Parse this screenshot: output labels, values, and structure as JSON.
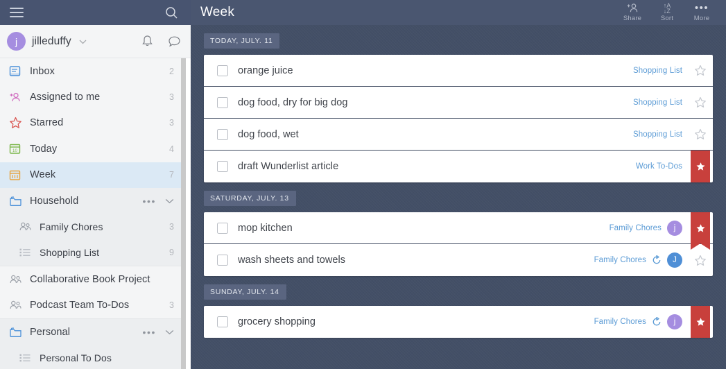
{
  "sidebar": {
    "topbar": {
      "menu_icon": "hamburger-icon",
      "search_icon": "search-icon"
    },
    "user": {
      "avatar_initial": "j",
      "name": "jilleduffy",
      "avatar_color": "#a58de0",
      "chevron_icon": "chevron-down-icon",
      "bell_icon": "bell-icon",
      "chat_icon": "chat-bubble-icon"
    },
    "smart_lists": [
      {
        "label": "Inbox",
        "count": "2",
        "icon": "inbox-icon",
        "color": "#4a90d9"
      },
      {
        "label": "Assigned to me",
        "count": "3",
        "icon": "assigned-person-icon",
        "color": "#d16ec0"
      },
      {
        "label": "Starred",
        "count": "3",
        "icon": "star-icon",
        "color": "#d9534f"
      },
      {
        "label": "Today",
        "count": "4",
        "icon": "calendar-today-icon",
        "color": "#7ab648"
      },
      {
        "label": "Week",
        "count": "7",
        "icon": "calendar-week-icon",
        "color": "#e8a33d",
        "active": true
      }
    ],
    "folders": [
      {
        "label": "Household",
        "icon": "folder-icon",
        "more_icon": "ellipsis-icon",
        "collapse_icon": "chevron-down-icon",
        "children": [
          {
            "label": "Family Chores",
            "count": "3",
            "icon": "shared-list-icon"
          },
          {
            "label": "Shopping List",
            "count": "9",
            "icon": "list-icon"
          }
        ]
      }
    ],
    "standalone_lists": [
      {
        "label": "Collaborative Book Project",
        "count": "",
        "icon": "shared-list-icon"
      },
      {
        "label": "Podcast Team To-Dos",
        "count": "3",
        "icon": "shared-list-icon"
      }
    ],
    "folders_2": [
      {
        "label": "Personal",
        "icon": "folder-icon",
        "more_icon": "ellipsis-icon",
        "collapse_icon": "chevron-down-icon",
        "children": [
          {
            "label": "Personal To Dos",
            "count": "",
            "icon": "list-icon"
          }
        ]
      }
    ]
  },
  "header": {
    "title": "Week",
    "actions": [
      {
        "label": "Share",
        "icon": "share-person-icon"
      },
      {
        "label": "Sort",
        "icon": "sort-az-icon",
        "glyph_top": "↑A",
        "glyph_bottom": "↓Z"
      },
      {
        "label": "More",
        "icon": "ellipsis-icon"
      }
    ]
  },
  "colors": {
    "accent_blue": "#5b9bd5",
    "star_red": "#c8403c",
    "avatar_purple": "#a58de0",
    "avatar_blue": "#4f8fd6",
    "background": "#434f66",
    "header_bar": "#4a5670",
    "active_row": "#dbe9f5"
  },
  "groups": [
    {
      "date_label": "TODAY, JULY. 11",
      "tasks": [
        {
          "title": "orange juice",
          "list": "Shopping List",
          "starred": false,
          "recurring": false,
          "assignee": null
        },
        {
          "title": "dog food, dry for big dog",
          "list": "Shopping List",
          "starred": false,
          "recurring": false,
          "assignee": null
        },
        {
          "title": "dog food, wet",
          "list": "Shopping List",
          "starred": false,
          "recurring": false,
          "assignee": null
        },
        {
          "title": "draft Wunderlist article",
          "list": "Work To-Dos",
          "starred": true,
          "recurring": false,
          "assignee": null
        }
      ]
    },
    {
      "date_label": "SATURDAY, JULY. 13",
      "tasks": [
        {
          "title": "mop kitchen",
          "list": "Family Chores",
          "starred": true,
          "recurring": false,
          "assignee": {
            "initial": "j",
            "color": "#a58de0"
          }
        },
        {
          "title": "wash sheets and towels",
          "list": "Family Chores",
          "starred": false,
          "recurring": true,
          "assignee": {
            "initial": "J",
            "color": "#4f8fd6"
          }
        }
      ]
    },
    {
      "date_label": "SUNDAY, JULY. 14",
      "tasks": [
        {
          "title": "grocery shopping",
          "list": "Family Chores",
          "starred": true,
          "recurring": true,
          "assignee": {
            "initial": "j",
            "color": "#a58de0"
          }
        }
      ]
    }
  ]
}
